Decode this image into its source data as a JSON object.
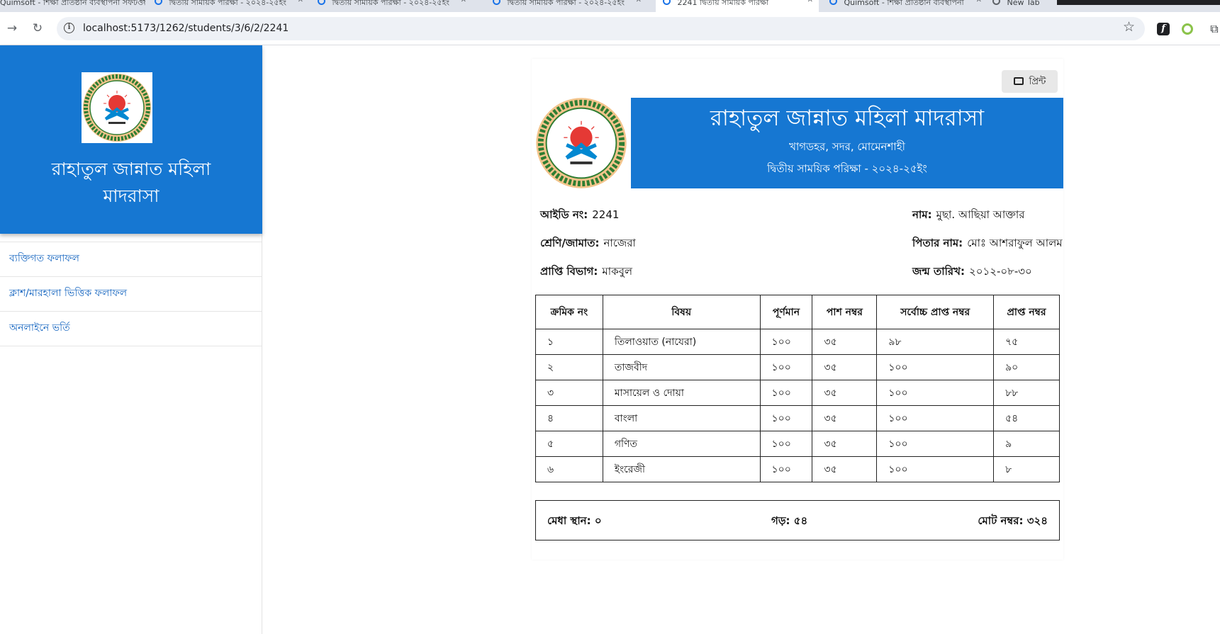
{
  "browser": {
    "tabs": [
      {
        "title": "Quimsoft - শিক্ষা প্রতিষ্ঠান ব্যবস্থাপনা সফটওয়্যার"
      },
      {
        "title": "দ্বিতীয় সাময়িক পরিক্ষা - ২০২৪-২৫ইং"
      },
      {
        "title": "দ্বিতীয় সাময়িক পরিক্ষা - ২০২৪-২৫ইং"
      },
      {
        "title": "দ্বিতীয় সাময়িক পরিক্ষা - ২০২৪-২৫ইং"
      },
      {
        "title": "2241 দ্বিতীয় সাময়িক পরিক্ষা"
      },
      {
        "title": "Quimsoft - শিক্ষা প্রতিষ্ঠান ব্যবস্থাপনা"
      },
      {
        "title": "New Tab"
      }
    ],
    "url": "localhost:5173/1262/students/3/6/2/2241"
  },
  "sidebar": {
    "title_line1": "রাহাতুল জান্নাত মহিলা",
    "title_line2": "মাদরাসা",
    "items": [
      {
        "label": "ব্যক্তিগত ফলাফল"
      },
      {
        "label": "ক্লাশ/মারহালা ভিত্তিক ফলাফল"
      },
      {
        "label": "অনলাইনে ভর্তি"
      }
    ]
  },
  "report": {
    "print_label": "প্রিন্ট",
    "institution_name": "রাহাতুল জান্নাত মহিলা মাদরাসা",
    "address": "খাগডহর, সদর, মোমেনশাহী",
    "exam_title": "দ্বিতীয় সাময়িক পরিক্ষা - ২০২৪-২৫ইং",
    "student": {
      "id_label": "আইডি নং:",
      "id_value": "2241",
      "name_label": "নাম:",
      "name_value": "মুছা. আছিয়া আক্তার",
      "class_label": "শ্রেণি/জামাত:",
      "class_value": "নাজেরা",
      "father_label": "পিতার নাম:",
      "father_value": "মোঃ আশরাফুল আলম",
      "division_label": "প্রাপ্তি বিভাগ:",
      "division_value": "মাকবুল",
      "dob_label": "জন্ম তারিখ:",
      "dob_value": "২০১২-০৮-৩০"
    },
    "table": {
      "headers": [
        "ক্রমিক নং",
        "বিষয়",
        "পূর্ণমান",
        "পাশ নম্বর",
        "সর্বোচ্চ প্রাপ্ত নম্বর",
        "প্রাপ্ত নম্বর"
      ],
      "rows": [
        [
          "১",
          "তিলাওয়াত (নাযেরা)",
          "১০০",
          "৩৫",
          "৯৮",
          "৭৫"
        ],
        [
          "২",
          "তাজবীদ",
          "১০০",
          "৩৫",
          "১০০",
          "৯০"
        ],
        [
          "৩",
          "মাসায়েল ও দোয়া",
          "১০০",
          "৩৫",
          "১০০",
          "৮৮"
        ],
        [
          "৪",
          "বাংলা",
          "১০০",
          "৩৫",
          "১০০",
          "৫৪"
        ],
        [
          "৫",
          "গণিত",
          "১০০",
          "৩৫",
          "১০০",
          "৯"
        ],
        [
          "৬",
          "ইংরেজী",
          "১০০",
          "৩৫",
          "১০০",
          "৮"
        ]
      ]
    },
    "summary": {
      "merit_label": "মেধা স্থান:",
      "merit_value": "০",
      "avg_label": "গড়:",
      "avg_value": "৫৪",
      "total_label": "মোট নম্বর:",
      "total_value": "৩২৪"
    }
  },
  "colors": {
    "brand_blue": "#1677d2",
    "link_blue": "#1565c0"
  }
}
